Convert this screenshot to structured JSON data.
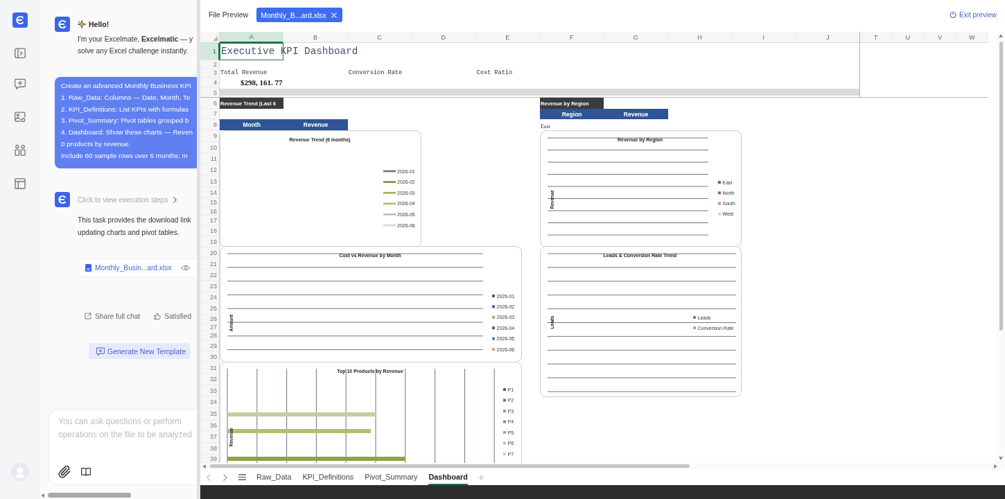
{
  "chat": {
    "messages": [
      {
        "kind": "greeting",
        "title": "Hello!",
        "lines": [
          "I'm your Excelmate, **Excelmatic** — y",
          "solve any Excel challenge instantly."
        ]
      },
      {
        "kind": "request",
        "lines": [
          "Create an advanced Monthly Business KPI",
          "1. Raw_Data: Columns — Date, Month, Te",
          "2. KPI_Definitions: List KPIs with formulas",
          "3. Pivot_Summary: Pivot tables grouped b",
          "4. Dashboard: Show these charts — Reven",
          "0 products by revenue.",
          "Include 60 sample rows over 6 months; m"
        ]
      },
      {
        "kind": "result",
        "steps_link": "Click to view execution steps",
        "lines": [
          "This task provides the download link",
          "updating charts and pivot tables."
        ],
        "file": "Monthly_Busin...ard.xlsx"
      }
    ],
    "actions": [
      {
        "kind": "share",
        "label": "Share full chat"
      },
      {
        "kind": "like",
        "label": "Satisfied"
      }
    ],
    "template_button": "Generate New Template",
    "input": {
      "placeholder": "You can ask questions or perform operations on the file to be analyzed"
    }
  },
  "preview": {
    "title": "File Preview",
    "tabs": [
      {
        "label": "Monthly_B...ard.xlsx",
        "selected": true
      }
    ],
    "exit_button": "Exit preview"
  },
  "sheet": {
    "columns": [
      {
        "label": "A",
        "selected": true
      },
      {
        "label": "B",
        "selected": false
      },
      {
        "label": "C",
        "selected": false
      },
      {
        "label": "D",
        "selected": false
      },
      {
        "label": "E",
        "selected": false
      },
      {
        "label": "F",
        "selected": false
      },
      {
        "label": "G",
        "selected": false
      },
      {
        "label": "H",
        "selected": false
      },
      {
        "label": "I",
        "selected": false
      },
      {
        "label": "J",
        "selected": false
      },
      {
        "label": "T",
        "selected": false
      },
      {
        "label": "U",
        "selected": false
      },
      {
        "label": "V",
        "selected": false
      },
      {
        "label": "W",
        "selected": false
      }
    ],
    "rows": [
      {
        "label": "1",
        "selected": true,
        "cells": {
          "A": {
            "kind": "title",
            "text": "Executive KPI Dashboard"
          }
        }
      },
      {
        "label": "2",
        "selected": false
      },
      {
        "label": "3",
        "selected": false,
        "cells": {
          "A": {
            "kind": "label",
            "text": "Total Revenue"
          },
          "C": {
            "kind": "label",
            "text": "Conversion Rate"
          },
          "E": {
            "kind": "label",
            "text": "Cost Ratio"
          }
        }
      },
      {
        "label": "4",
        "selected": false,
        "cells": {
          "A": {
            "kind": "value",
            "text": "$298, 161. 77"
          }
        }
      },
      {
        "label": "5",
        "selected": false
      },
      {
        "label": "6",
        "selected": false,
        "cells": {
          "A": {
            "kind": "section",
            "text": "Revenue Trend (Last 6"
          },
          "F": {
            "kind": "section",
            "text": "Revenue by Region"
          }
        }
      },
      {
        "label": "7",
        "selected": false,
        "cells": {
          "F": {
            "kind": "header",
            "text": "Region"
          },
          "G": {
            "kind": "header",
            "text": "Revenue"
          }
        }
      },
      {
        "label": "8",
        "selected": false,
        "cells": {
          "A": {
            "kind": "header",
            "text": "Month"
          },
          "B": {
            "kind": "header",
            "text": "Revenue"
          },
          "F": {
            "kind": "plain",
            "text": "East"
          }
        }
      },
      {
        "label": "9",
        "selected": false
      },
      {
        "label": "10",
        "selected": false
      },
      {
        "label": "11",
        "selected": false
      },
      {
        "label": "12",
        "selected": false
      },
      {
        "label": "13",
        "selected": false
      },
      {
        "label": "14",
        "selected": false
      },
      {
        "label": "15",
        "selected": false
      },
      {
        "label": "16",
        "selected": false
      },
      {
        "label": "17",
        "selected": false
      },
      {
        "label": "18",
        "selected": false
      },
      {
        "label": "19",
        "selected": false
      },
      {
        "label": "20",
        "selected": false
      },
      {
        "label": "21",
        "selected": false
      },
      {
        "label": "22",
        "selected": false
      },
      {
        "label": "23",
        "selected": false
      },
      {
        "label": "24",
        "selected": false
      },
      {
        "label": "25",
        "selected": false
      },
      {
        "label": "26",
        "selected": false
      },
      {
        "label": "27",
        "selected": false
      },
      {
        "label": "28",
        "selected": false
      },
      {
        "label": "29",
        "selected": false
      },
      {
        "label": "30",
        "selected": false
      },
      {
        "label": "31",
        "selected": false
      },
      {
        "label": "32",
        "selected": false
      },
      {
        "label": "33",
        "selected": false
      },
      {
        "label": "34",
        "selected": false
      },
      {
        "label": "35",
        "selected": false
      },
      {
        "label": "36",
        "selected": false
      },
      {
        "label": "37",
        "selected": false
      },
      {
        "label": "38",
        "selected": false
      },
      {
        "label": "39",
        "selected": false
      }
    ],
    "charts": [
      {
        "kind": "line",
        "title": "Revenue Trend (6 months)",
        "legend": [
          {
            "label": "2026-01",
            "color": "#6e7a58"
          },
          {
            "label": "2026-02",
            "color": "#7d8f45"
          },
          {
            "label": "2026-03",
            "color": "#9cb14f"
          },
          {
            "label": "2026-04",
            "color": "#aabb78"
          },
          {
            "label": "2026-05",
            "color": "#bdbdb5"
          },
          {
            "label": "2026-06",
            "color": "#d8dccb"
          }
        ]
      },
      {
        "kind": "column",
        "title": "Cost vs Revenue by Month",
        "axis_label": "Amount",
        "legend": [
          {
            "label": "2026-01",
            "color": "#4e5866"
          },
          {
            "label": "2026-02",
            "color": "#8a4d6a"
          },
          {
            "label": "2026-03",
            "color": "#9fae75"
          },
          {
            "label": "2026-04",
            "color": "#57606a"
          },
          {
            "label": "2026-05",
            "color": "#6f7a84"
          },
          {
            "label": "2026-06",
            "color": "#d9a27a"
          }
        ]
      },
      {
        "kind": "bar",
        "title": "Top 10 Products by Revenue",
        "axis_label": "Revenue",
        "legend": [
          {
            "label": "P1",
            "color": "#5a6270"
          },
          {
            "label": "P2",
            "color": "#6b7580"
          },
          {
            "label": "P3",
            "color": "#8f9aa0"
          },
          {
            "label": "P4",
            "color": "#7a8a90"
          },
          {
            "label": "P5",
            "color": "#9aa8a0"
          },
          {
            "label": "P6",
            "color": "#b8c8b0"
          },
          {
            "label": "P7",
            "color": "#c8d0c8"
          }
        ]
      },
      {
        "kind": "column",
        "title": "Revenue by Region",
        "axis_label": "Revenue",
        "legend": [
          {
            "label": "East",
            "color": "#8e4a67"
          },
          {
            "label": "North",
            "color": "#9d5877"
          },
          {
            "label": "South",
            "color": "#c48fa8"
          },
          {
            "label": "West",
            "color": "#ddd0d6"
          }
        ]
      },
      {
        "kind": "combo",
        "title": "Leads & Conversion Rate Trend",
        "axis_label": "Leads",
        "legend": [
          {
            "label": "Leads",
            "color": "#7b7ba6"
          },
          {
            "label": "Conversion Rate",
            "color": "#a5a5a5"
          }
        ]
      }
    ],
    "tabs": [
      {
        "label": "Raw_Data",
        "selected": false
      },
      {
        "label": "KPI_Definitions",
        "selected": false
      },
      {
        "label": "Pivot_Summary",
        "selected": false
      },
      {
        "label": "Dashboard",
        "selected": true
      }
    ]
  }
}
